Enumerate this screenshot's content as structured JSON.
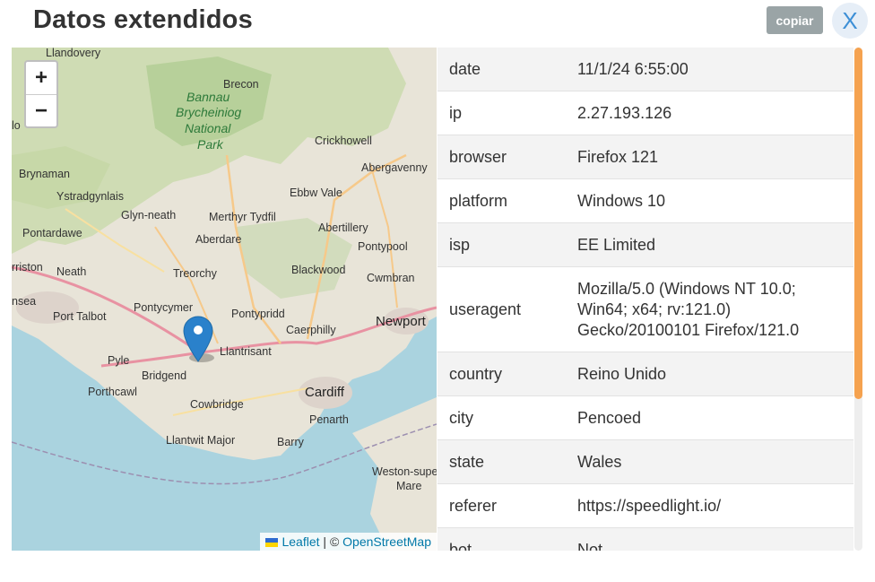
{
  "header": {
    "title": "Datos extendidos",
    "copy_label": "copiar",
    "close_label": "X"
  },
  "map": {
    "zoom_in": "+",
    "zoom_out": "−",
    "attribution": {
      "leaflet": "Leaflet",
      "separator": " | © ",
      "osm": "OpenStreetMap"
    },
    "places": {
      "llandovery": "Llandovery",
      "brecon": "Brecon",
      "bannau": "Bannau",
      "brycheiniog": "Brycheiniog",
      "national": "National",
      "park": "Park",
      "crickhowell": "Crickhowell",
      "abergavenny": "Abergavenny",
      "brynaman": "Brynaman",
      "ystradgynlais": "Ystradgynlais",
      "ebbw_vale": "Ebbw Vale",
      "glyn_neath": "Glyn-neath",
      "merthyr": "Merthyr Tydfil",
      "abertillery": "Abertillery",
      "pontardawe": "Pontardawe",
      "aberdare": "Aberdare",
      "pontypool": "Pontypool",
      "gorseinon": "rriston",
      "neath": "Neath",
      "treorchy": "Treorchy",
      "blackwood": "Blackwood",
      "cwmbran": "Cwmbran",
      "swansea": "nsea",
      "port_talbot": "Port Talbot",
      "pontycymer": "Pontycymer",
      "pontypridd": "Pontypridd",
      "newport": "Newport",
      "caerphilly": "Caerphilly",
      "llantrisant": "Llantrisant",
      "pyle": "Pyle",
      "bridgend": "Bridgend",
      "porthcawl": "Porthcawl",
      "cardiff": "Cardiff",
      "cowbridge": "Cowbridge",
      "penarth": "Penarth",
      "llantwit": "Llantwit Major",
      "barry": "Barry",
      "weston": "Weston-supe",
      "mare": "Mare",
      "lo": "lo"
    },
    "marker_icon": "map-pin-icon"
  },
  "details": {
    "rows": [
      {
        "key": "date",
        "value": "11/1/24 6:55:00"
      },
      {
        "key": "ip",
        "value": "2.27.193.126"
      },
      {
        "key": "browser",
        "value": "Firefox 121"
      },
      {
        "key": "platform",
        "value": "Windows 10"
      },
      {
        "key": "isp",
        "value": "EE Limited"
      },
      {
        "key": "useragent",
        "value": "Mozilla/5.0 (Windows NT 10.0; Win64; x64; rv:121.0) Gecko/20100101 Firefox/121.0"
      },
      {
        "key": "country",
        "value": "Reino Unido"
      },
      {
        "key": "city",
        "value": "Pencoed"
      },
      {
        "key": "state",
        "value": "Wales"
      },
      {
        "key": "referer",
        "value": "https://speedlight.io/"
      },
      {
        "key": "bot",
        "value": "Not"
      }
    ]
  },
  "colors": {
    "accent": "#f5a24f",
    "marker": "#2a81cb",
    "copy_bg": "#9aa4a6"
  }
}
